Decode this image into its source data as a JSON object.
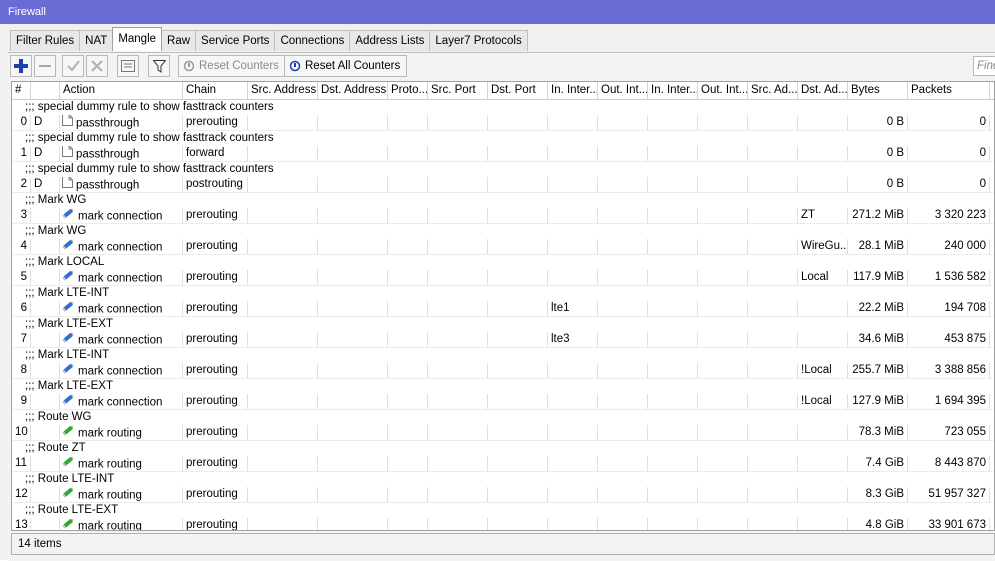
{
  "window": {
    "title": "Firewall"
  },
  "tabs": [
    {
      "label": "Filter Rules",
      "active": false
    },
    {
      "label": "NAT",
      "active": false
    },
    {
      "label": "Mangle",
      "active": true
    },
    {
      "label": "Raw",
      "active": false
    },
    {
      "label": "Service Ports",
      "active": false
    },
    {
      "label": "Connections",
      "active": false
    },
    {
      "label": "Address Lists",
      "active": false
    },
    {
      "label": "Layer7 Protocols",
      "active": false
    }
  ],
  "toolbar": {
    "reset_counters_label": "Reset Counters",
    "reset_all_counters_label": "Reset All Counters",
    "find_placeholder": "Find"
  },
  "columns": [
    "#",
    "",
    "Action",
    "Chain",
    "Src. Address",
    "Dst. Address",
    "Proto...",
    "Src. Port",
    "Dst. Port",
    "In. Inter...",
    "Out. Int...",
    "In. Inter...",
    "Out. Int...",
    "Src. Ad...",
    "Dst. Ad...",
    "Bytes",
    "Packets"
  ],
  "rules": [
    {
      "comment": ";;; special dummy rule to show fasttrack counters",
      "num": "0",
      "flag": "D",
      "action": "passthrough",
      "icon": "page-icon",
      "chain": "prerouting",
      "in_interface": "",
      "dst_address_list": "",
      "bytes": "0 B",
      "packets": "0"
    },
    {
      "comment": ";;; special dummy rule to show fasttrack counters",
      "num": "1",
      "flag": "D",
      "action": "passthrough",
      "icon": "page-icon",
      "chain": "forward",
      "in_interface": "",
      "dst_address_list": "",
      "bytes": "0 B",
      "packets": "0"
    },
    {
      "comment": ";;; special dummy rule to show fasttrack counters",
      "num": "2",
      "flag": "D",
      "action": "passthrough",
      "icon": "page-icon",
      "chain": "postrouting",
      "in_interface": "",
      "dst_address_list": "",
      "bytes": "0 B",
      "packets": "0"
    },
    {
      "comment": ";;; Mark WG",
      "num": "3",
      "flag": "",
      "action": "mark connection",
      "icon": "pencil-blue-icon",
      "chain": "prerouting",
      "in_interface": "",
      "dst_address_list": "ZT",
      "bytes": "271.2 MiB",
      "packets": "3 320 223"
    },
    {
      "comment": ";;; Mark WG",
      "num": "4",
      "flag": "",
      "action": "mark connection",
      "icon": "pencil-blue-icon",
      "chain": "prerouting",
      "in_interface": "",
      "dst_address_list": "WireGu...",
      "bytes": "28.1 MiB",
      "packets": "240 000"
    },
    {
      "comment": ";;; Mark LOCAL",
      "num": "5",
      "flag": "",
      "action": "mark connection",
      "icon": "pencil-blue-icon",
      "chain": "prerouting",
      "in_interface": "",
      "dst_address_list": "Local",
      "bytes": "117.9 MiB",
      "packets": "1 536 582"
    },
    {
      "comment": ";;; Mark LTE-INT",
      "num": "6",
      "flag": "",
      "action": "mark connection",
      "icon": "pencil-blue-icon",
      "chain": "prerouting",
      "in_interface": "lte1",
      "dst_address_list": "",
      "bytes": "22.2 MiB",
      "packets": "194 708"
    },
    {
      "comment": ";;; Mark LTE-EXT",
      "num": "7",
      "flag": "",
      "action": "mark connection",
      "icon": "pencil-blue-icon",
      "chain": "prerouting",
      "in_interface": "lte3",
      "dst_address_list": "",
      "bytes": "34.6 MiB",
      "packets": "453 875"
    },
    {
      "comment": ";;; Mark LTE-INT",
      "num": "8",
      "flag": "",
      "action": "mark connection",
      "icon": "pencil-blue-icon",
      "chain": "prerouting",
      "in_interface": "",
      "dst_address_list": "!Local",
      "bytes": "255.7 MiB",
      "packets": "3 388 856"
    },
    {
      "comment": ";;; Mark LTE-EXT",
      "num": "9",
      "flag": "",
      "action": "mark connection",
      "icon": "pencil-blue-icon",
      "chain": "prerouting",
      "in_interface": "",
      "dst_address_list": "!Local",
      "bytes": "127.9 MiB",
      "packets": "1 694 395"
    },
    {
      "comment": ";;; Route WG",
      "num": "10",
      "flag": "",
      "action": "mark routing",
      "icon": "pencil-green-icon",
      "chain": "prerouting",
      "in_interface": "",
      "dst_address_list": "",
      "bytes": "78.3 MiB",
      "packets": "723 055"
    },
    {
      "comment": ";;; Route ZT",
      "num": "11",
      "flag": "",
      "action": "mark routing",
      "icon": "pencil-green-icon",
      "chain": "prerouting",
      "in_interface": "",
      "dst_address_list": "",
      "bytes": "7.4 GiB",
      "packets": "8 443 870"
    },
    {
      "comment": ";;; Route LTE-INT",
      "num": "12",
      "flag": "",
      "action": "mark routing",
      "icon": "pencil-green-icon",
      "chain": "prerouting",
      "in_interface": "",
      "dst_address_list": "",
      "bytes": "8.3 GiB",
      "packets": "51 957 327"
    },
    {
      "comment": ";;; Route LTE-EXT",
      "num": "13",
      "flag": "",
      "action": "mark routing",
      "icon": "pencil-green-icon",
      "chain": "prerouting",
      "in_interface": "",
      "dst_address_list": "",
      "bytes": "4.8 GiB",
      "packets": "33 901 673"
    }
  ],
  "status": {
    "items_count": "14 items"
  },
  "colors": {
    "titlebar": "#6b6bd6",
    "add_icon": "#1c3fae",
    "mark_connection_icon": "#2d6fd6",
    "mark_routing_icon": "#2fa82f"
  }
}
